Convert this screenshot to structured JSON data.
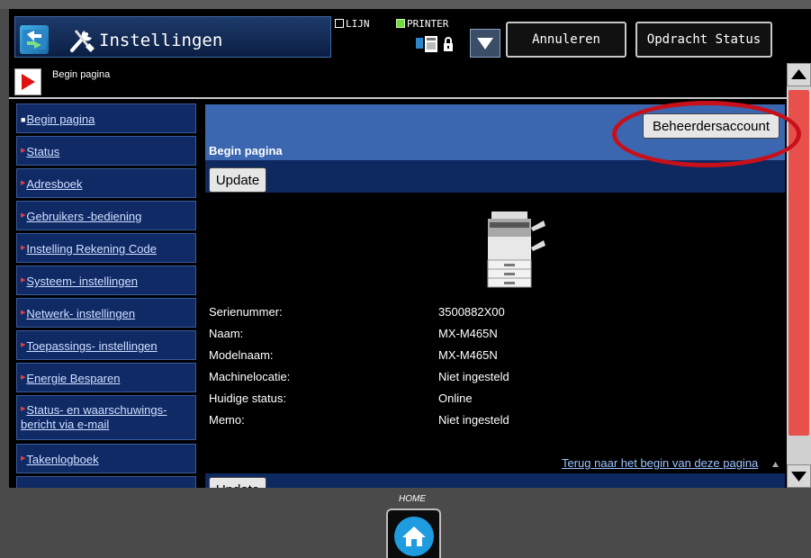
{
  "header": {
    "app_title": "Instellingen",
    "line_label": "LIJN",
    "printer_label": "PRINTER",
    "cancel_label": "Annuleren",
    "job_status_label": "Opdracht Status"
  },
  "breadcrumb": {
    "text": "Begin pagina"
  },
  "sidebar": {
    "items": [
      {
        "label": "Begin pagina",
        "active": true
      },
      {
        "label": "Status"
      },
      {
        "label": "Adresboek"
      },
      {
        "label": "Gebruikers -bediening"
      },
      {
        "label": "Instelling Rekening Code"
      },
      {
        "label": "Systeem- instellingen"
      },
      {
        "label": "Netwerk- instellingen"
      },
      {
        "label": "Toepassings- instellingen"
      },
      {
        "label": "Energie Besparen"
      },
      {
        "label_line1": "Status- en waarschuwings-",
        "label_line2": "bericht via e-mail"
      },
      {
        "label": "Takenlogboek"
      }
    ]
  },
  "main": {
    "page_heading": "Begin pagina",
    "admin_button": "Beheerdersaccount",
    "update_button": "Update",
    "update_button_bottom": "Update",
    "info": [
      {
        "label": "Serienummer:",
        "value": "3500882X00"
      },
      {
        "label": "Naam:",
        "value": "MX-M465N"
      },
      {
        "label": "Modelnaam:",
        "value": "MX-M465N"
      },
      {
        "label": "Machinelocatie:",
        "value": "Niet ingesteld"
      },
      {
        "label": "Huidige status:",
        "value": "Online"
      },
      {
        "label": "Memo:",
        "value": "Niet ingesteld"
      }
    ],
    "back_to_top": "Terug naar het begin van deze pagina"
  },
  "footer": {
    "home_label": "HOME"
  },
  "colors": {
    "accent_blue": "#3b66b0",
    "nav_blue": "#102a66",
    "scroll_thumb": "#e8504c",
    "annotation": "#c8101a"
  }
}
